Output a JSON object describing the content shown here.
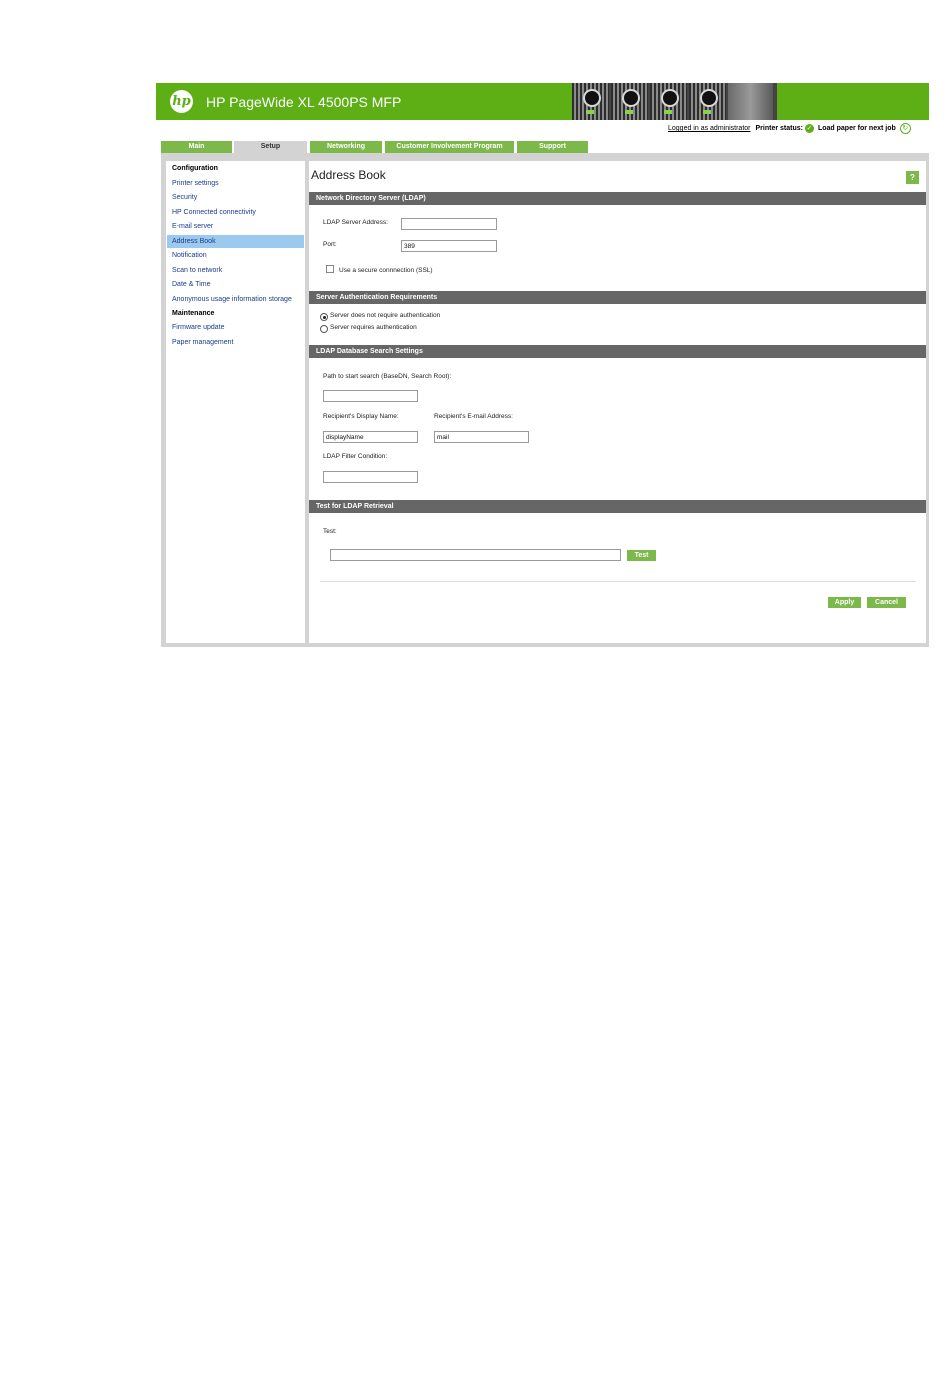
{
  "header": {
    "logo_text": "hp",
    "product_name": "HP PageWide XL 4500PS MFP"
  },
  "status": {
    "logged_in": "Logged in as administrator",
    "printer_status_label": "Printer status:",
    "printer_status_message": "Load paper for next job",
    "status_icon": "check-circle-icon",
    "refresh_icon": "refresh-icon"
  },
  "tabs": [
    {
      "label": "Main",
      "active": false
    },
    {
      "label": "Setup",
      "active": true
    },
    {
      "label": "Networking",
      "active": false
    },
    {
      "label": "Customer Involvement Program",
      "active": false
    },
    {
      "label": "Support",
      "active": false
    }
  ],
  "sidebar": {
    "configuration_heading": "Configuration",
    "config_items": [
      "Printer settings",
      "Security",
      "HP Connected connectivity",
      "E-mail server",
      "Address Book",
      "Notification",
      "Scan to network",
      "Date & Time",
      "Anonymous usage information storage"
    ],
    "selected_item": "Address Book",
    "maintenance_heading": "Maintenance",
    "maintenance_items": [
      "Firmware update",
      "Paper management"
    ]
  },
  "main": {
    "title": "Address Book",
    "help_label": "?",
    "ldap_section": {
      "heading": "Network Directory Server (LDAP)",
      "server_address_label": "LDAP Server Address:",
      "server_address_value": "",
      "port_label": "Port:",
      "port_value": "389",
      "ssl_label": "Use a secure connnection (SSL)",
      "ssl_checked": false
    },
    "auth_section": {
      "heading": "Server Authentication Requirements",
      "options": [
        "Server does not require authentication",
        "Server requires authentication"
      ],
      "selected": "Server does not require authentication"
    },
    "search_section": {
      "heading": "LDAP Database Search Settings",
      "path_label": "Path to start search (BaseDN, Search Root):",
      "path_value": "",
      "display_name_label": "Recipient's Display Name:",
      "display_name_value": "displayName",
      "email_label": "Recipient's E-mail Address:",
      "email_value": "mail",
      "filter_label": "LDAP Filter Condition:",
      "filter_value": ""
    },
    "test_section": {
      "heading": "Test for LDAP Retrieval",
      "test_label": "Test:",
      "test_value": "",
      "test_button": "Test"
    },
    "apply_button": "Apply",
    "cancel_button": "Cancel"
  },
  "colors": {
    "brand_green": "#5daf15",
    "button_green": "#7cb84a",
    "section_bar": "#666666",
    "selected_nav": "#9cc9ee",
    "link_blue": "#1a3c8c"
  }
}
